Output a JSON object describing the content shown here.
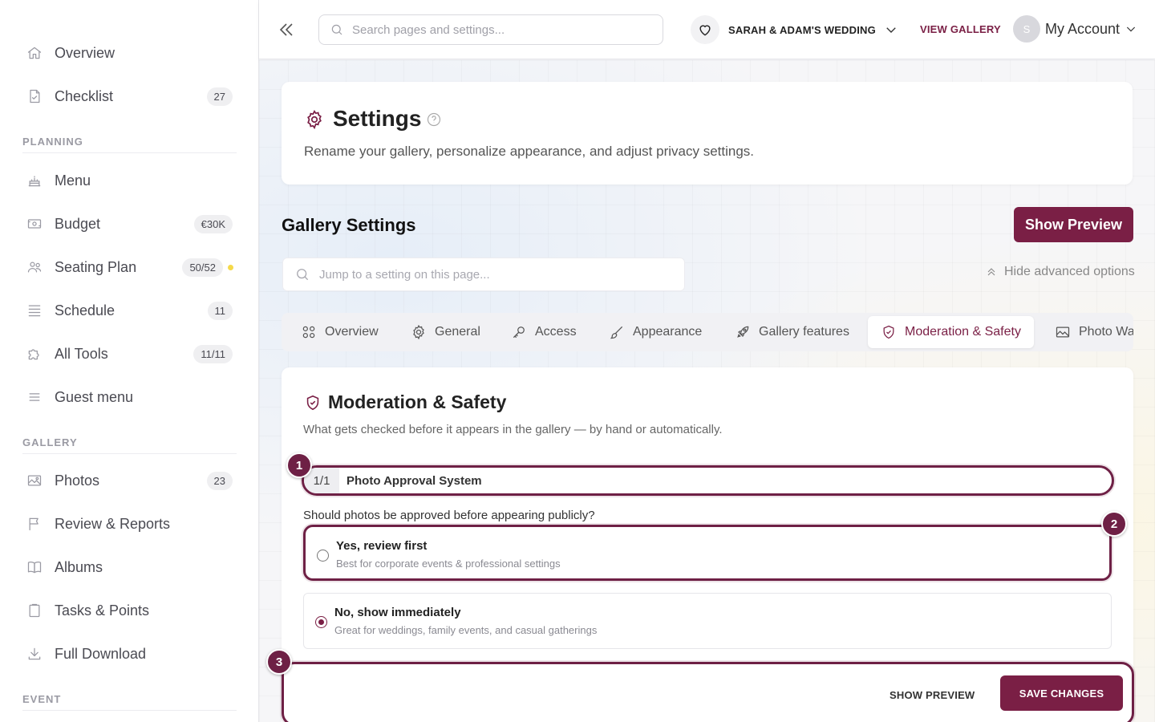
{
  "sidebar": {
    "top_items": [
      {
        "label": "Overview",
        "icon": "home-icon"
      },
      {
        "label": "Checklist",
        "icon": "checklist-icon",
        "badge": "27"
      }
    ],
    "planning_label": "PLANNING",
    "planning_items": [
      {
        "label": "Menu",
        "icon": "cake-icon"
      },
      {
        "label": "Budget",
        "icon": "money-icon",
        "badge": "€30K"
      },
      {
        "label": "Seating Plan",
        "icon": "people-icon",
        "badge": "50/52",
        "dot_color": "#f5d94a"
      },
      {
        "label": "Schedule",
        "icon": "schedule-icon",
        "badge": "11"
      },
      {
        "label": "All Tools",
        "icon": "puzzle-icon",
        "badge": "11/11"
      },
      {
        "label": "Guest menu",
        "icon": "menu-lines-icon"
      }
    ],
    "gallery_label": "GALLERY",
    "gallery_items": [
      {
        "label": "Photos",
        "icon": "image-icon",
        "badge": "23"
      },
      {
        "label": "Review & Reports",
        "icon": "flag-icon"
      },
      {
        "label": "Albums",
        "icon": "book-icon"
      },
      {
        "label": "Tasks & Points",
        "icon": "clipboard-icon"
      },
      {
        "label": "Full Download",
        "icon": "download-icon"
      }
    ],
    "event_label": "EVENT"
  },
  "topbar": {
    "search_placeholder": "Search pages and settings...",
    "event_name": "SARAH & ADAM'S WEDDING",
    "view_gallery": "VIEW GALLERY",
    "avatar_initial": "S",
    "account_label": "My Account"
  },
  "header": {
    "title": "Settings",
    "description": "Rename your gallery, personalize appearance, and adjust privacy settings."
  },
  "gallery_settings": {
    "title": "Gallery Settings",
    "show_preview": "Show Preview",
    "jump_placeholder": "Jump to a setting on this page...",
    "hide_advanced": "Hide advanced options"
  },
  "tabs": [
    {
      "label": "Overview",
      "icon": "grid-icon"
    },
    {
      "label": "General",
      "icon": "gear-icon"
    },
    {
      "label": "Access",
      "icon": "key-icon"
    },
    {
      "label": "Appearance",
      "icon": "brush-icon"
    },
    {
      "label": "Gallery features",
      "icon": "rocket-icon"
    },
    {
      "label": "Moderation & Safety",
      "icon": "shield-check-icon",
      "active": true
    },
    {
      "label": "Photo Wa",
      "icon": "image-icon"
    }
  ],
  "moderation": {
    "title": "Moderation & Safety",
    "description": "What gets checked before it appears in the gallery — by hand or automatically.",
    "approval_count": "1/1",
    "approval_label": "Photo Approval System",
    "question": "Should photos be approved before appearing publicly?",
    "options": [
      {
        "title": "Yes, review first",
        "subtitle": "Best for corporate events & professional settings",
        "selected": false
      },
      {
        "title": "No, show immediately",
        "subtitle": "Great for weddings, family events, and casual gatherings",
        "selected": true
      }
    ],
    "footer_preview": "SHOW PREVIEW",
    "footer_save": "SAVE CHANGES"
  },
  "markers": [
    "1",
    "2",
    "3"
  ],
  "colors": {
    "accent": "#7a1f45",
    "highlight": "#6e2045",
    "dot": "#f5d94a"
  }
}
